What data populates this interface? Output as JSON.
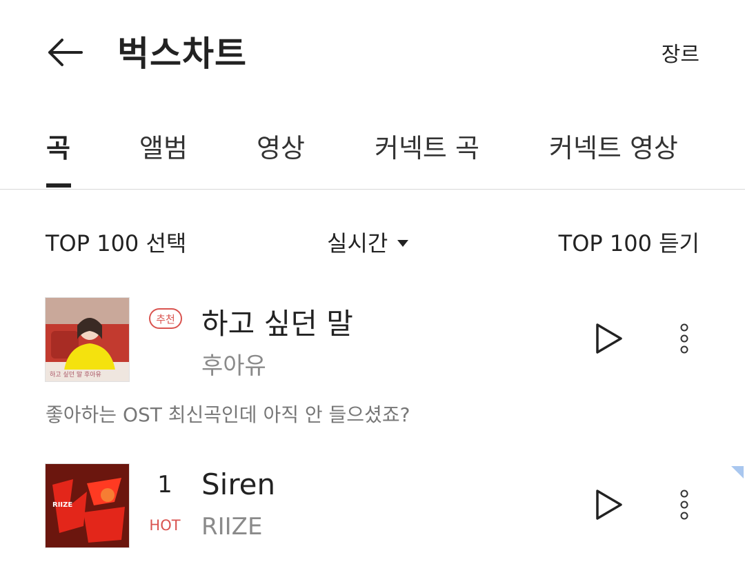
{
  "header": {
    "title": "벅스차트",
    "genre_label": "장르"
  },
  "tabs": [
    {
      "label": "곡",
      "active": true
    },
    {
      "label": "앨범",
      "active": false
    },
    {
      "label": "영상",
      "active": false
    },
    {
      "label": "커넥트 곡",
      "active": false
    },
    {
      "label": "커넥트 영상",
      "active": false
    }
  ],
  "controls": {
    "select_label": "TOP 100 선택",
    "period_label": "실시간",
    "listen_label": "TOP 100 듣기"
  },
  "recommended": {
    "badge": "추천",
    "title": "하고 싶던 말",
    "artist": "후아유",
    "description": "좋아하는 OST 최신곡인데 아직 안 들으셨죠?",
    "cover_caption": "하고 싶던 말 후아유"
  },
  "chart": [
    {
      "rank": "1",
      "status": "HOT",
      "title": "Siren",
      "artist": "RIIZE",
      "cover_text": "RIIZE"
    }
  ],
  "colors": {
    "accent_red": "#d9534f",
    "text_primary": "#222222",
    "text_secondary": "#8a8a8a"
  }
}
